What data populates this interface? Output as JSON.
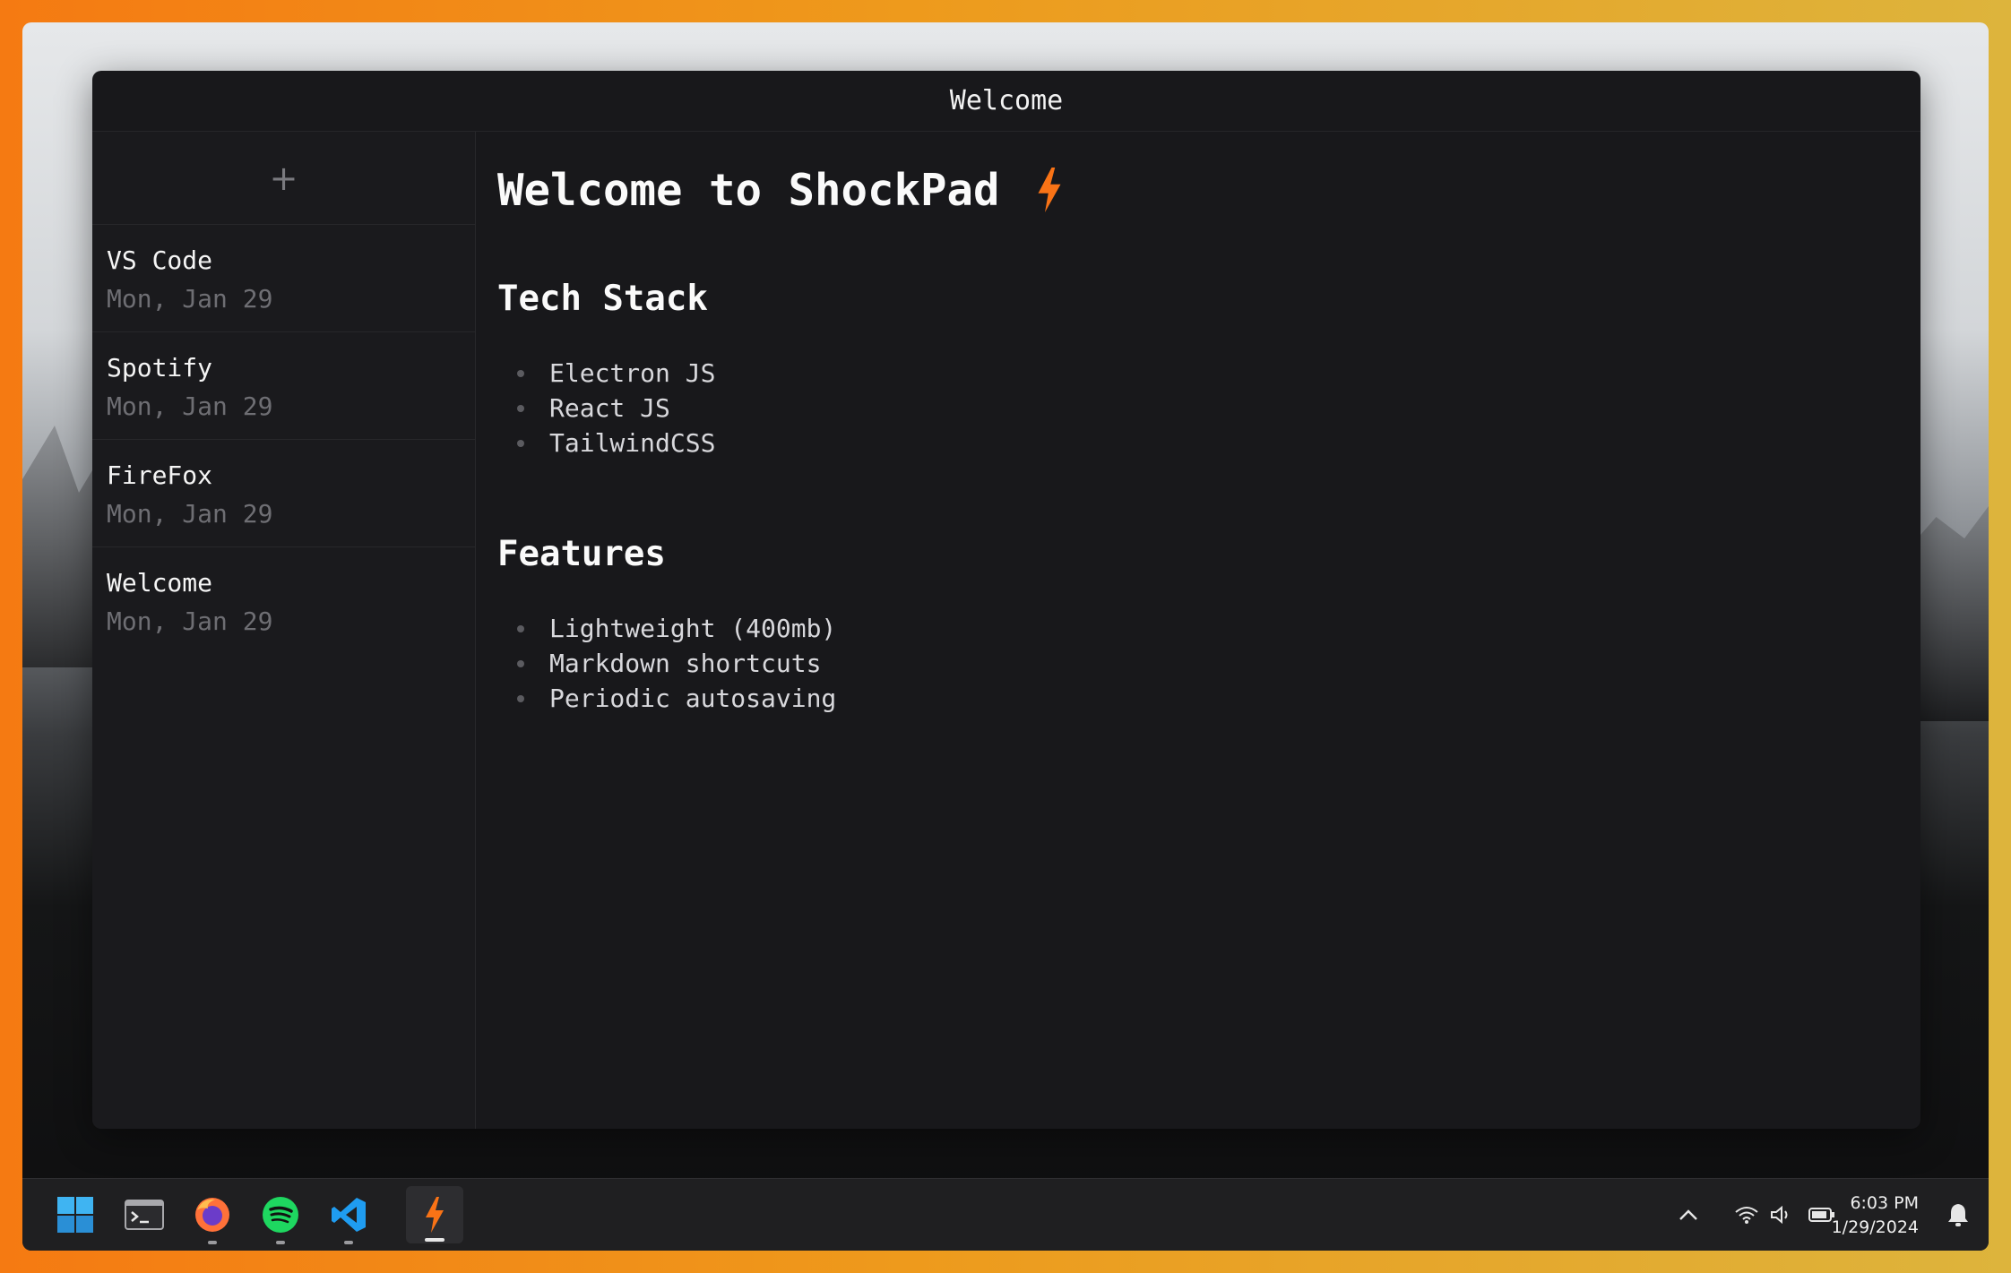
{
  "window": {
    "title": "Welcome"
  },
  "sidebar": {
    "add_label": "+",
    "notes": [
      {
        "title": "VS Code",
        "date": "Mon, Jan 29"
      },
      {
        "title": "Spotify",
        "date": "Mon, Jan 29"
      },
      {
        "title": "FireFox",
        "date": "Mon, Jan 29"
      },
      {
        "title": "Welcome",
        "date": "Mon, Jan 29"
      }
    ]
  },
  "editor": {
    "heading": "Welcome to ShockPad",
    "sections": [
      {
        "title": "Tech Stack",
        "items": [
          "Electron JS",
          "React JS",
          "TailwindCSS"
        ]
      },
      {
        "title": "Features",
        "items": [
          "Lightweight (400mb)",
          "Markdown shortcuts",
          "Periodic autosaving"
        ]
      }
    ]
  },
  "taskbar": {
    "apps": [
      "windows-start-icon",
      "terminal-icon",
      "firefox-icon",
      "spotify-icon",
      "vscode-icon",
      "shockpad-icon"
    ],
    "clock": {
      "time": "6:03 PM",
      "date": "1/29/2024"
    }
  },
  "colors": {
    "accent": "#f97316",
    "window_bg": "#18181b",
    "sidebar_bg": "#1a1a1d"
  }
}
